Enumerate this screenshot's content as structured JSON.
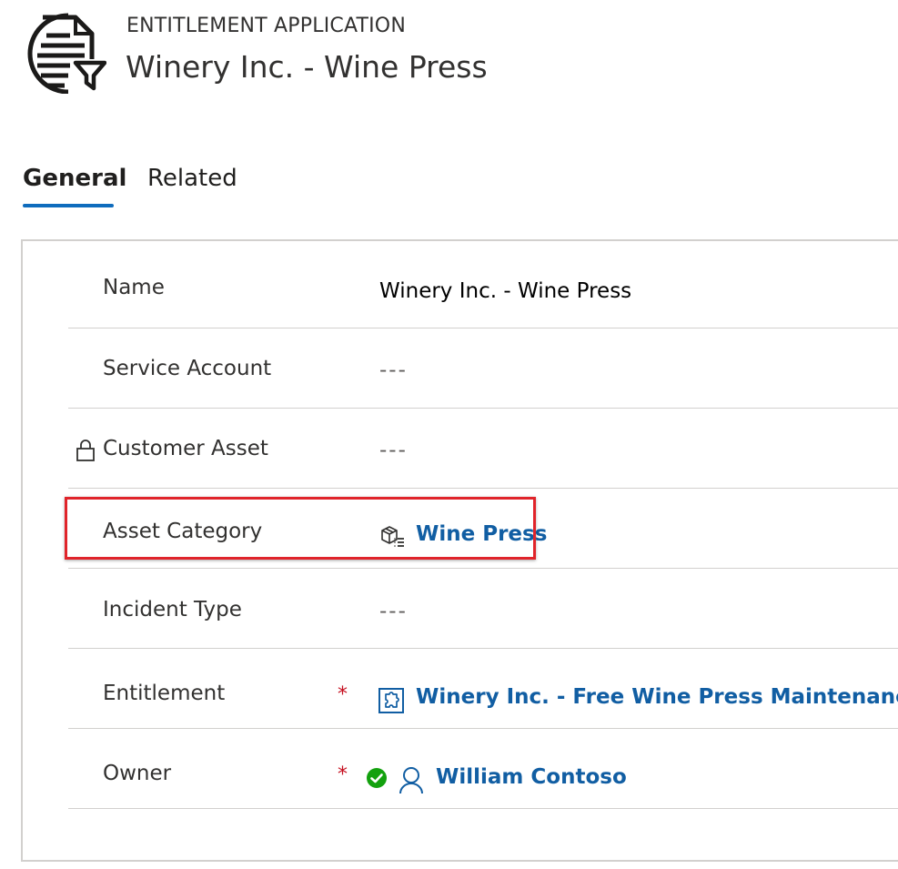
{
  "header": {
    "record_type": "ENTITLEMENT APPLICATION",
    "record_title": "Winery Inc. - Wine Press",
    "icon": "entitlement-application-icon"
  },
  "tabs": [
    {
      "label": "General",
      "selected": true
    },
    {
      "label": "Related",
      "selected": false
    }
  ],
  "form": {
    "fields": [
      {
        "label": "Name",
        "value": "Winery Inc. - Wine Press",
        "kind": "text",
        "required": false,
        "locked": false
      },
      {
        "label": "Service Account",
        "value": "---",
        "kind": "empty",
        "required": false,
        "locked": false
      },
      {
        "label": "Customer Asset",
        "value": "---",
        "kind": "empty",
        "required": false,
        "locked": true,
        "lock_icon": "lock-icon"
      },
      {
        "label": "Asset Category",
        "value": "Wine Press",
        "kind": "lookup",
        "required": false,
        "locked": false,
        "icon": "asset-category-icon",
        "highlighted": true
      },
      {
        "label": "Incident Type",
        "value": "---",
        "kind": "empty",
        "required": false,
        "locked": false
      },
      {
        "label": "Entitlement",
        "value": "Winery Inc. - Free Wine Press Maintenance",
        "kind": "lookup",
        "required": true,
        "locked": false,
        "icon": "entitlement-icon"
      },
      {
        "label": "Owner",
        "value": "William Contoso",
        "kind": "lookup",
        "required": true,
        "locked": false,
        "icon": "user-icon",
        "status_icon": "available-status-icon"
      }
    ],
    "required_marker": "*"
  },
  "colors": {
    "link": "#115ea3",
    "tab_underline": "#0f6cbd",
    "required": "#c50f1f",
    "highlight": "#e0242a",
    "status_available": "#13a10e"
  }
}
